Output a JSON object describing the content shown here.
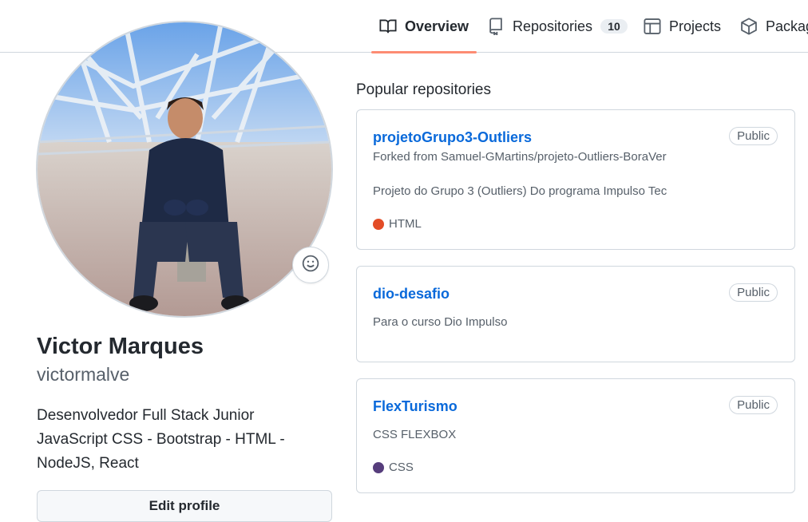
{
  "nav": {
    "tabs": [
      {
        "label": "Overview",
        "icon": "book-icon"
      },
      {
        "label": "Repositories",
        "icon": "repo-icon",
        "count": "10"
      },
      {
        "label": "Projects",
        "icon": "table-icon"
      },
      {
        "label": "Packag",
        "icon": "package-icon"
      }
    ]
  },
  "profile": {
    "name": "Victor Marques",
    "login": "victormalve",
    "bio_line1": "Desenvolvedor Full Stack Junior",
    "bio_line2": "JavaScript CSS - Bootstrap - HTML -",
    "bio_line3": "NodeJS, React",
    "edit_label": "Edit profile"
  },
  "popular": {
    "title": "Popular repositories",
    "repos": [
      {
        "name": "projetoGrupo3-Outliers",
        "visibility": "Public",
        "forked_from": "Forked from Samuel-GMartins/projeto-Outliers-BoraVer",
        "description": "Projeto do Grupo 3 (Outliers) Do programa Impulso Tec",
        "language": "HTML",
        "language_color": "#e34c26"
      },
      {
        "name": "dio-desafio",
        "visibility": "Public",
        "description": "Para o curso Dio Impulso"
      },
      {
        "name": "FlexTurismo",
        "visibility": "Public",
        "description": "CSS FLEXBOX",
        "language": "CSS",
        "language_color": "#563d7c"
      }
    ]
  },
  "colors": {
    "accent_underline": "#fd8c73",
    "link": "#0969da",
    "border": "#d0d7de"
  }
}
